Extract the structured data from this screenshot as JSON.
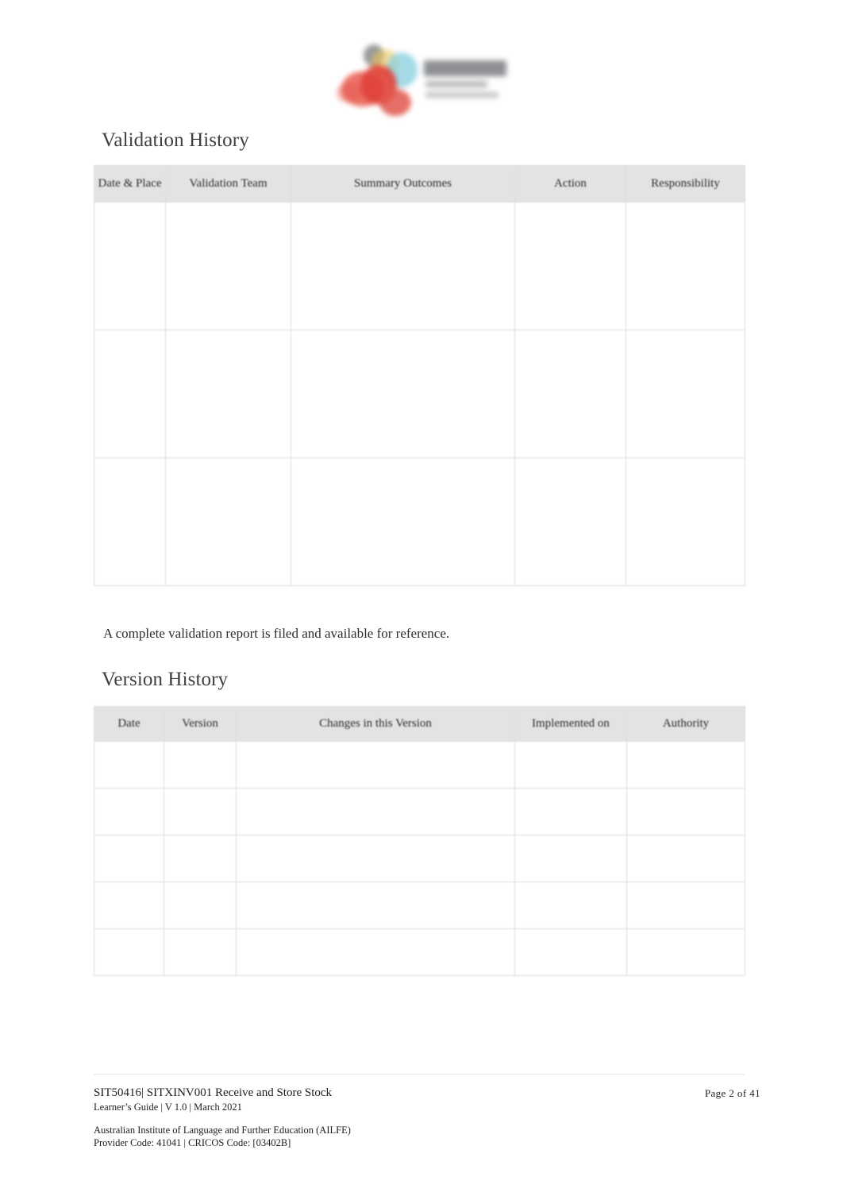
{
  "document": {
    "logo": {
      "mark_name": "ailfe-logo-mark",
      "colors": [
        "#e0413a",
        "#e8564a",
        "#86cfdd",
        "#efc75a",
        "#6d6f72"
      ],
      "wordmark_legible": ""
    },
    "sections": [
      {
        "id": "validation",
        "heading": "Validation History"
      },
      {
        "id": "version",
        "heading": "Version History"
      }
    ],
    "validation_table": {
      "columns": [
        "Date & Place",
        "Validation Team",
        "Summary Outcomes",
        "Action",
        "Responsibility"
      ],
      "rows": [
        [
          "",
          "",
          "",
          "",
          ""
        ],
        [
          "",
          "",
          "",
          "",
          ""
        ],
        [
          "",
          "",
          "",
          "",
          ""
        ]
      ]
    },
    "note": "A complete validation report is filed and available for reference.",
    "version_table": {
      "columns": [
        "Date",
        "Version",
        "Changes in this Version",
        "Implemented on",
        "Authority"
      ],
      "rows": [
        [
          "",
          "",
          "",
          "",
          ""
        ],
        [
          "",
          "",
          "",
          "",
          ""
        ],
        [
          "",
          "",
          "",
          "",
          ""
        ],
        [
          "",
          "",
          "",
          "",
          ""
        ],
        [
          "",
          "",
          "",
          "",
          ""
        ]
      ]
    },
    "footer": {
      "title": "SIT50416| SITXINV001 Receive and Store Stock",
      "subtitle": "Learner’s Guide | V 1.0 | March 2021",
      "page_label": "Page  2  of  41",
      "organisation": "Australian Institute of Language and Further Education (AILFE)",
      "codes": "Provider Code: 41041 | CRICOS Code: [03402B]"
    }
  }
}
